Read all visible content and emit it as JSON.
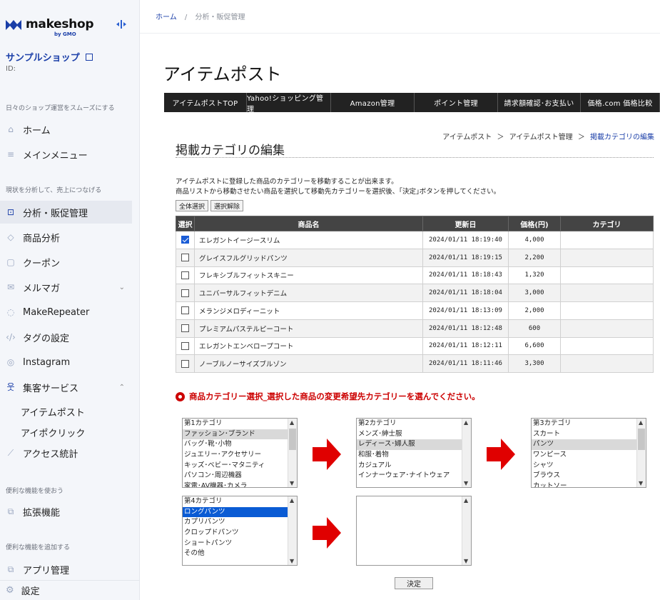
{
  "sidebar": {
    "logo_text": "makeshop",
    "logo_sub": "by GMO",
    "shop_name": "サンプルショップ",
    "shop_id": "ID:",
    "sections": [
      "日々のショップ運営をスムーズにする",
      "現状を分析して、売上につなげる",
      "便利な機能を使おう",
      "便利な機能を追加する"
    ],
    "items": [
      {
        "label": "ホーム",
        "icon": "home-icon"
      },
      {
        "label": "メインメニュー",
        "icon": "menu-icon"
      },
      {
        "label": "分析・販促管理",
        "icon": "chart-icon"
      },
      {
        "label": "商品分析",
        "icon": "tag-icon"
      },
      {
        "label": "クーポン",
        "icon": "coupon-icon"
      },
      {
        "label": "メルマガ",
        "icon": "mail-icon"
      },
      {
        "label": "MakeRepeater",
        "icon": "repeat-icon"
      },
      {
        "label": "タグの設定",
        "icon": "code-icon"
      },
      {
        "label": "Instagram",
        "icon": "instagram-icon"
      },
      {
        "label": "集客サービス",
        "icon": "users-icon"
      },
      {
        "label": "アクセス統計",
        "icon": "stats-icon"
      },
      {
        "label": "拡張機能",
        "icon": "puzzle-icon"
      },
      {
        "label": "アプリ管理",
        "icon": "puzzle-icon"
      }
    ],
    "sub_items": [
      "アイテムポスト",
      "アイポクリック"
    ],
    "settings_label": "設定"
  },
  "breadcrumb_top": {
    "home": "ホーム",
    "sep": "/",
    "current": "分析・販促管理"
  },
  "page_title": "アイテムポスト",
  "tabs": [
    "アイテムポストTOP",
    "Yahoo!ショッピング管理",
    "Amazon管理",
    "ポイント管理",
    "請求額確認･お支払い",
    "価格.com 価格比較"
  ],
  "breadcrumb2": {
    "a": "アイテムポスト",
    "sep": "＞",
    "b": "アイテムポスト管理",
    "c": "掲載カテゴリの編集"
  },
  "section_title": "掲載カテゴリの編集",
  "desc1": "アイテムポストに登録した商品のカテゴリーを移動することが出来ます。",
  "desc2": "商品リストから移動させたい商品を選択して移動先カテゴリーを選択後、｢決定｣ボタンを押してください。",
  "select_all": "全体選択",
  "deselect_all": "選択解除",
  "table": {
    "headers": [
      "選択",
      "商品名",
      "更新日",
      "価格(円)",
      "カテゴリ"
    ],
    "rows": [
      {
        "checked": true,
        "name": "エレガントイージースリム",
        "date": "2024/01/11 18:19:40",
        "price": "4,000",
        "cat": ""
      },
      {
        "checked": false,
        "name": "グレイスフルグリッドパンツ",
        "date": "2024/01/11 18:19:15",
        "price": "2,200",
        "cat": ""
      },
      {
        "checked": false,
        "name": "フレキシブルフィットスキニー",
        "date": "2024/01/11 18:18:43",
        "price": "1,320",
        "cat": ""
      },
      {
        "checked": false,
        "name": "ユニバーサルフィットデニム",
        "date": "2024/01/11 18:18:04",
        "price": "3,000",
        "cat": ""
      },
      {
        "checked": false,
        "name": "メランジメロディーニット",
        "date": "2024/01/11 18:13:09",
        "price": "2,000",
        "cat": ""
      },
      {
        "checked": false,
        "name": "プレミアムパステルピーコート",
        "date": "2024/01/11 18:12:48",
        "price": "600",
        "cat": ""
      },
      {
        "checked": false,
        "name": "エレガントエンベロープコート",
        "date": "2024/01/11 18:12:11",
        "price": "6,600",
        "cat": ""
      },
      {
        "checked": false,
        "name": "ノーブルノーサイズブルゾン",
        "date": "2024/01/11 18:11:46",
        "price": "3,300",
        "cat": ""
      }
    ]
  },
  "alert": "商品カテゴリー選択_選択した商品の変更希望先カテゴリーを選んでください。",
  "listboxes": [
    {
      "options": [
        "第1カテゴリ",
        "ファッション･ブランド",
        "バッグ･靴･小物",
        "ジュエリー･アクセサリー",
        "キッズ･ベビー･マタニティ",
        "パソコン･周辺機器",
        "家電･AV機器･カメラ"
      ],
      "selected": 1,
      "style": "gray"
    },
    {
      "options": [
        "第2カテゴリ",
        "メンズ･紳士服",
        "レディース･婦人服",
        "和服･着物",
        "カジュアル",
        "インナーウェア･ナイトウェア"
      ],
      "selected": 2,
      "style": "gray"
    },
    {
      "options": [
        "第3カテゴリ",
        "スカート",
        "パンツ",
        "ワンピース",
        "シャツ",
        "ブラウス",
        "カットソー"
      ],
      "selected": 2,
      "style": "gray"
    },
    {
      "options": [
        "第4カテゴリ",
        "ロングパンツ",
        "カプリパンツ",
        "クロップドパンツ",
        "ショートパンツ",
        "その他"
      ],
      "selected": 1,
      "style": "blue"
    },
    {
      "options": [],
      "selected": -1,
      "style": "gray"
    }
  ],
  "decide_label": "決定",
  "colors": {
    "accent": "#1a3ea8",
    "alert": "#cc0000",
    "arrow": "#e00000",
    "tab_bg": "#222222"
  }
}
